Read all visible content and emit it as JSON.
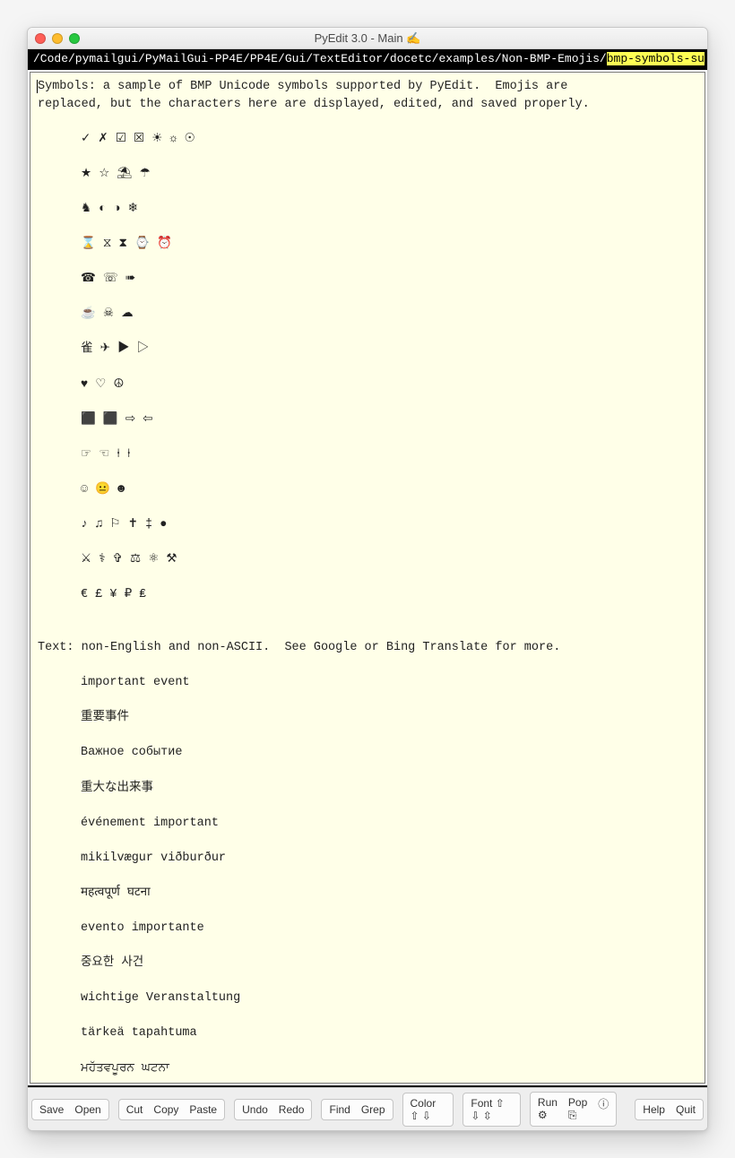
{
  "window": {
    "title": "PyEdit 3.0 - Main ✍"
  },
  "pathbar": {
    "prefix": "/Code/pymailgui/PyMailGui-PP4E/PP4E/Gui/TextEditor/docetc/examples/Non-BMP-Emojis/",
    "highlight": "bmp-symbols-su"
  },
  "content": {
    "intro_l1": "Symbols: a sample of BMP Unicode symbols supported by PyEdit.  Emojis are",
    "intro_l2": "replaced, but the characters here are displayed, edited, and saved properly.",
    "sym01": "✓ ✗ ☑ ☒ ☀ ☼ ☉",
    "sym02": "★ ☆ ⛱ ☂",
    "sym03": "♞ ◐ ◑ ❄",
    "sym04": "⌛ ⧖ ⧗ ⌚ ⏰",
    "sym05": "☎ ☏ ➠",
    "sym06": "☕ ☠ ☁",
    "sym07": "雀 ✈ ▶ ▷",
    "sym08": "♥ ♡ ☮",
    "sym09": "⬛ ⬛ ⇨ ⇦",
    "sym10": "☞ ☜ ⍿ ⍿",
    "sym11": "☺ 😐 ☻",
    "sym12": "♪ ♫ ⚐ ✝ ‡ ●",
    "sym13": "⚔ ⚕ ✞ ⚖ ⚛ ⚒",
    "sym14": "€ £ ¥ ₽ ₤",
    "text_hdr": "Text: non-English and non-ASCII.  See Google or Bing Translate for more.",
    "t01": "important event",
    "t02": "重要事件",
    "t03": "Важное событие",
    "t04": "重大な出来事",
    "t05": "événement important",
    "t06": "mikilvægur viðburður",
    "t07": "महत्वपूर्ण घटना",
    "t08": "evento importante",
    "t09": "중요한 사건",
    "t10": "wichtige Veranstaltung",
    "t11": "tärkeä tapahtuma",
    "t12": "ਮਹੱਤਵਪੂਰਨ ਘਟਨਾ"
  },
  "toolbar": {
    "save": "Save",
    "open": "Open",
    "cut": "Cut",
    "copy": "Copy",
    "paste": "Paste",
    "undo": "Undo",
    "redo": "Redo",
    "find": "Find",
    "grep": "Grep",
    "color": "Color ⇧ ⇩",
    "font": "Font ⇧ ⇩ ⇳",
    "run": "Run ⚙",
    "pop": "Pop ⎘",
    "info": "ⓘ",
    "help": "Help",
    "quit": "Quit"
  }
}
